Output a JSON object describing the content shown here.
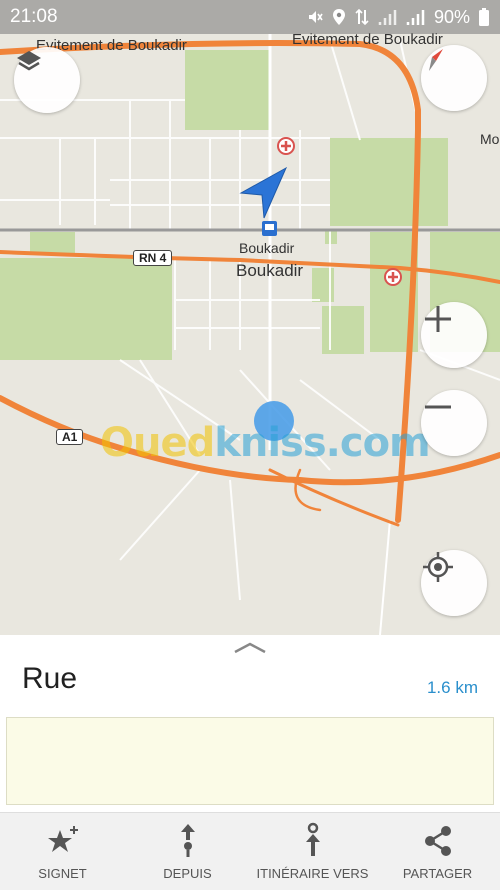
{
  "status_bar": {
    "time": "21:08",
    "battery": "90%"
  },
  "map": {
    "labels": {
      "bypass_left": "Evitement de Boukadir",
      "bypass_right": "Evitement de Boukadir",
      "station": "Boukadir",
      "town": "Boukadir",
      "edge_partial": "Mo"
    },
    "road_shields": {
      "rn4": "RN 4",
      "a1": "A1"
    },
    "watermark": {
      "part1": "Oued",
      "part2": "kniss.com"
    }
  },
  "panel": {
    "title": "Rue",
    "distance": "1.6 km",
    "note": ""
  },
  "actions": [
    {
      "label": "SIGNET",
      "icon": "star-plus-icon"
    },
    {
      "label": "DEPUIS",
      "icon": "route-from-icon"
    },
    {
      "label": "ITINÉRAIRE VERS",
      "icon": "route-to-icon"
    },
    {
      "label": "PARTAGER",
      "icon": "share-icon"
    }
  ],
  "colors": {
    "accent": "#2a8fcc",
    "road": "#f0843a",
    "park": "#c3d9a0"
  }
}
